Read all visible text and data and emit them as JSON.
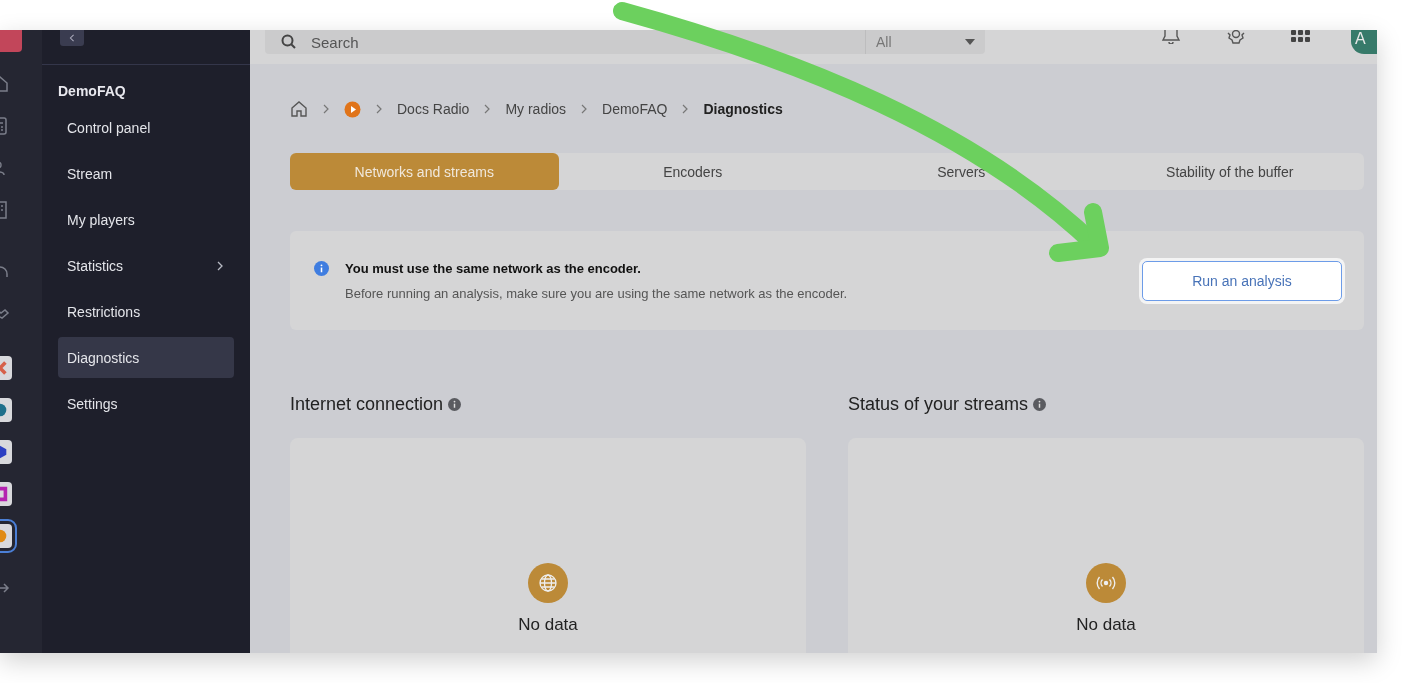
{
  "top_bar": {
    "search": {
      "placeholder": "Search"
    },
    "scope": "All",
    "avatar": "A"
  },
  "sidebar": {
    "radio_name": "DemoFAQ",
    "items": [
      {
        "label": "Control panel",
        "selected": false,
        "expandable": false
      },
      {
        "label": "Stream",
        "selected": false,
        "expandable": false
      },
      {
        "label": "My players",
        "selected": false,
        "expandable": false
      },
      {
        "label": "Statistics",
        "selected": false,
        "expandable": true
      },
      {
        "label": "Restrictions",
        "selected": false,
        "expandable": false
      },
      {
        "label": "Diagnostics",
        "selected": true,
        "expandable": false
      },
      {
        "label": "Settings",
        "selected": false,
        "expandable": false
      }
    ]
  },
  "breadcrumb": [
    {
      "label": "Docs Radio",
      "current": false
    },
    {
      "label": "My radios",
      "current": false
    },
    {
      "label": "DemoFAQ",
      "current": false
    },
    {
      "label": "Diagnostics",
      "current": true
    }
  ],
  "tabs": [
    {
      "label": "Networks and streams",
      "selected": true
    },
    {
      "label": "Encoders",
      "selected": false
    },
    {
      "label": "Servers",
      "selected": false
    },
    {
      "label": "Stability of the buffer",
      "selected": false
    }
  ],
  "notice": {
    "title": "You must use the same network as the encoder.",
    "text": "Before running an analysis, make sure you are using the same network as the encoder.",
    "button": "Run an analysis"
  },
  "panels": [
    {
      "title": "Internet connection",
      "kind": "globe",
      "empty_text": "No data"
    },
    {
      "title": "Status of your streams",
      "kind": "signal",
      "empty_text": "No data"
    }
  ]
}
